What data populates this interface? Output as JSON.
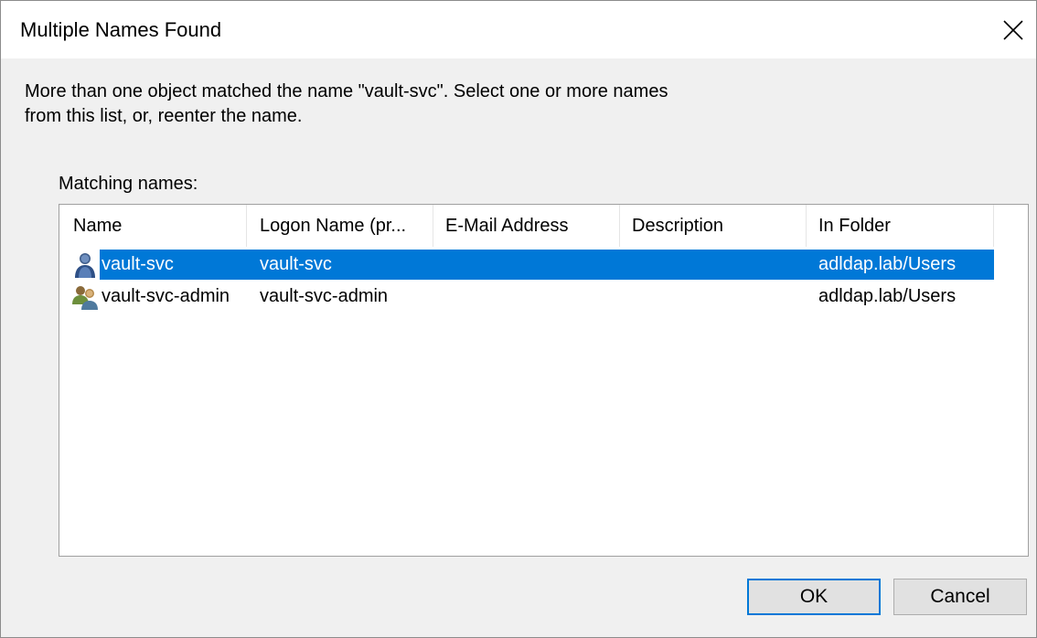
{
  "dialog": {
    "title": "Multiple Names Found",
    "message": "More than one object matched the name \"vault-svc\". Select one or more names from this list, or, reenter the name.",
    "matching_label": "Matching names:"
  },
  "list": {
    "columns": [
      "Name",
      "Logon Name (pr...",
      "E-Mail Address",
      "Description",
      "In Folder"
    ],
    "rows": [
      {
        "icon": "user-icon",
        "name": "vault-svc",
        "logon": "vault-svc",
        "email": "",
        "description": "",
        "folder": "adldap.lab/Users",
        "selected": true
      },
      {
        "icon": "group-icon",
        "name": "vault-svc-admin",
        "logon": "vault-svc-admin",
        "email": "",
        "description": "",
        "folder": "adldap.lab/Users",
        "selected": false
      }
    ]
  },
  "buttons": {
    "ok": "OK",
    "cancel": "Cancel"
  },
  "colors": {
    "selection": "#0078d7",
    "dialog_bg": "#f0f0f0"
  }
}
